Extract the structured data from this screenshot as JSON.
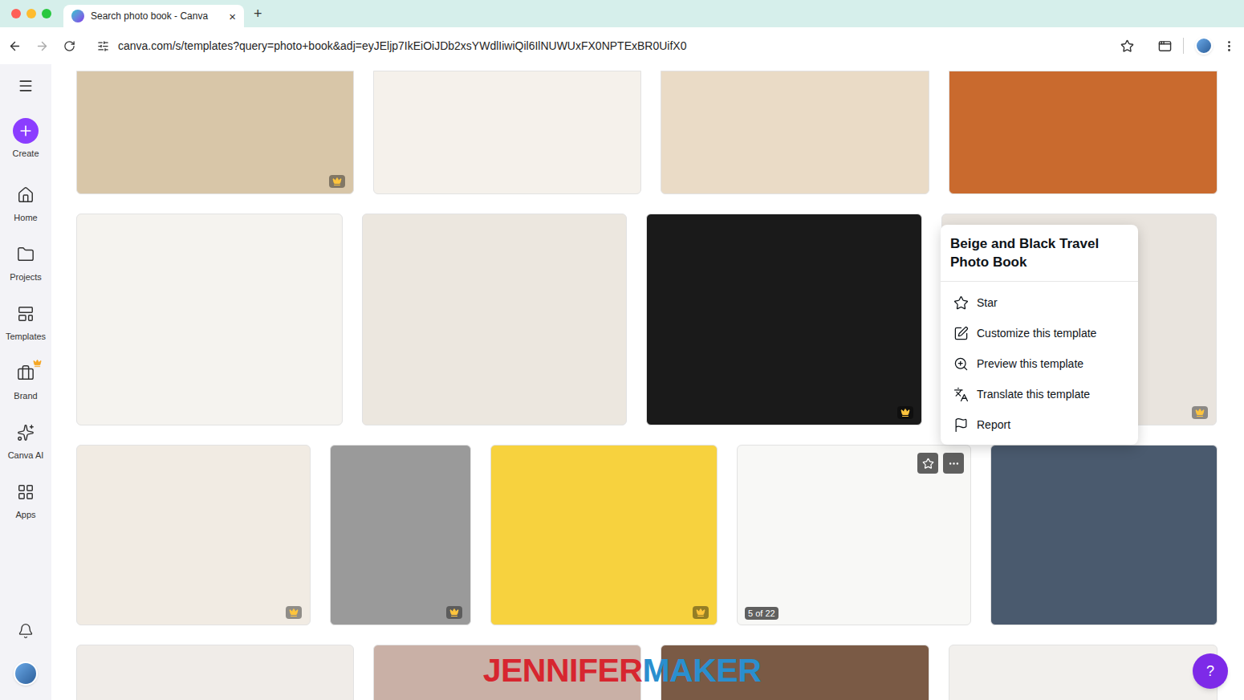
{
  "browser": {
    "tab": {
      "title": "Search photo book - Canva",
      "close": "×"
    },
    "new_tab": "+",
    "url": "canva.com/s/templates?query=photo+book&adj=eyJEljp7IkEiOiJDb2xsYWdlIiwiQil6IlNUWUxFX0NPTExBR0UifX0",
    "bookmarked": false
  },
  "sidebar": {
    "items": [
      {
        "label": "Create",
        "selected": false
      },
      {
        "label": "Home",
        "selected": false
      },
      {
        "label": "Projects",
        "selected": false
      },
      {
        "label": "Templates",
        "selected": false
      },
      {
        "label": "Brand",
        "selected": false
      },
      {
        "label": "Canva AI",
        "selected": false
      },
      {
        "label": "Apps",
        "selected": false
      }
    ]
  },
  "grid": {
    "rows": [
      {
        "cards": [
          {
            "premium": true,
            "hovered": false
          },
          {
            "premium": false,
            "hovered": false
          },
          {
            "premium": false,
            "hovered": false
          },
          {
            "premium": false,
            "hovered": false
          }
        ]
      },
      {
        "cards": [
          {
            "premium": false,
            "hovered": false
          },
          {
            "premium": false,
            "hovered": false
          },
          {
            "premium": true,
            "hovered": false
          },
          {
            "premium": true,
            "hovered": false
          }
        ]
      },
      {
        "cards": [
          {
            "premium": true,
            "hovered": false
          },
          {
            "premium": true,
            "hovered": false
          },
          {
            "premium": true,
            "hovered": false
          },
          {
            "premium": false,
            "hovered": true,
            "badge": "5 of 22"
          },
          {
            "premium": false,
            "hovered": false
          }
        ]
      },
      {
        "cards": [
          {
            "premium": false,
            "hovered": false
          },
          {
            "premium": false,
            "hovered": false
          },
          {
            "premium": false,
            "hovered": false
          },
          {
            "premium": false,
            "hovered": false
          }
        ]
      }
    ]
  },
  "context_menu": {
    "title": "Beige and Black Travel Photo Book",
    "items": [
      {
        "label": "Star"
      },
      {
        "label": "Customize this template"
      },
      {
        "label": "Preview this template"
      },
      {
        "label": "Translate this template"
      },
      {
        "label": "Report"
      }
    ]
  },
  "help_button": "?",
  "watermark": {
    "parts": [
      {
        "text": "JENNIFER",
        "color": "#d7262f"
      },
      {
        "text": "MAKER",
        "color": "#2a8fcf"
      }
    ]
  }
}
